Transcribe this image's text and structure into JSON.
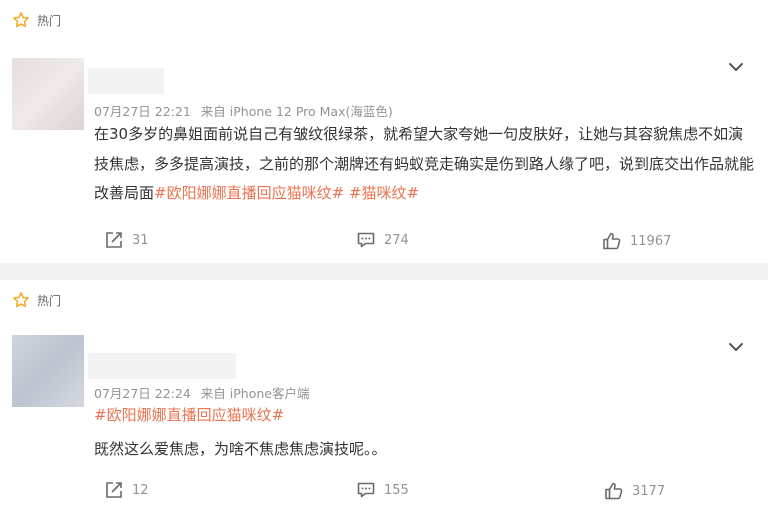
{
  "posts": [
    {
      "hot_label": "热门",
      "date": "07月27日 22:21",
      "source_prefix": "来自",
      "source": "iPhone 12 Pro Max(海蓝色)",
      "text": "在30多岁的鼻姐面前说自己有皱纹很绿茶，就希望大家夸她一句皮肤好，让她与其容貌焦虑不如演技焦虑，多多提高演技，之前的那个潮牌还有蚂蚁竞走确实是伤到路人缘了吧，说到底交出作品就能改善局面",
      "tags": [
        "#欧阳娜娜直播回应猫咪纹#",
        "#猫咪纹#"
      ],
      "reposts": "31",
      "comments": "274",
      "likes": "11967"
    },
    {
      "hot_label": "热门",
      "date": "07月27日 22:24",
      "source_prefix": "来自",
      "source": "iPhone客户端",
      "tag": "#欧阳娜娜直播回应猫咪纹#",
      "text": "既然这么爱焦虑，为啥不焦虑焦虑演技呢。。",
      "reposts": "12",
      "comments": "155",
      "likes": "3177"
    }
  ],
  "icons": {
    "hot": "star-outline-icon",
    "menu": "chevron-down-icon",
    "repost": "share-icon",
    "comment": "comment-icon",
    "like": "thumbs-up-icon"
  },
  "colors": {
    "tag": "#eb7350",
    "meta": "#939393",
    "star": "#f5a623",
    "background": "#f2f2f2"
  }
}
